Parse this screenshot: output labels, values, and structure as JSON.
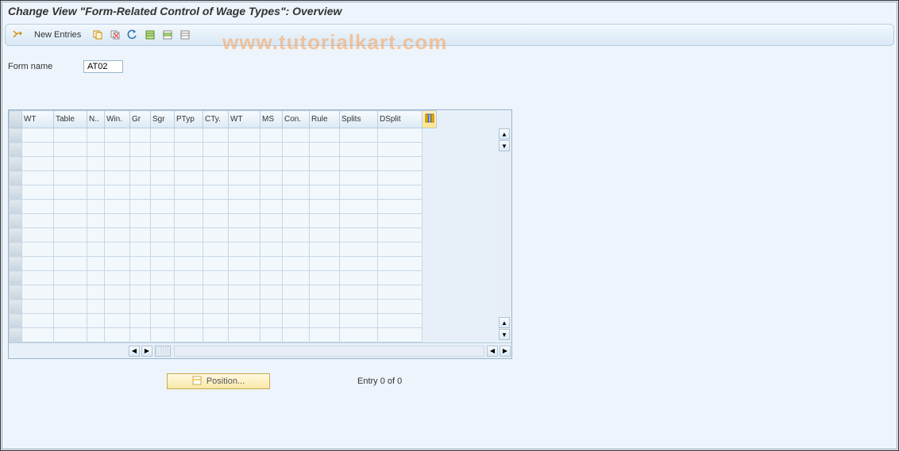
{
  "title": "Change View \"Form-Related Control of Wage Types\": Overview",
  "watermark": "www.tutorialkart.com",
  "toolbar": {
    "new_entries_label": "New Entries",
    "icons": {
      "toggle": "toggle-icon",
      "copy": "copy-icon",
      "delete": "delete-icon",
      "undo": "undo-icon",
      "select_all": "select-all-icon",
      "select_block": "select-block-icon",
      "deselect": "deselect-icon"
    }
  },
  "form": {
    "name_label": "Form name",
    "name_value": "AT02"
  },
  "table": {
    "columns": [
      "WT",
      "Table",
      "N..",
      "Win.",
      "Gr",
      "Sgr",
      "PTyp",
      "CTy.",
      "WT",
      "MS",
      "Con.",
      "Rule",
      "Splits",
      "DSplit"
    ],
    "rows": []
  },
  "footer": {
    "position_label": "Position...",
    "entry_text": "Entry 0 of 0"
  }
}
